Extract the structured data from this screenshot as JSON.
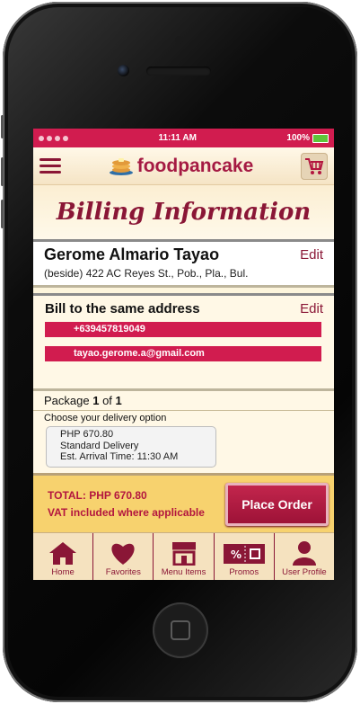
{
  "status": {
    "time": "11:11 AM",
    "battery": "100%"
  },
  "app": {
    "brand": "foodpancake"
  },
  "page": {
    "title": "Billing Information"
  },
  "address": {
    "name": "Gerome Almario Tayao",
    "line": "(beside) 422 AC Reyes St., Pob., Pla., Bul.",
    "edit_label": "Edit"
  },
  "billing": {
    "title": "Bill to the same address",
    "edit_label": "Edit",
    "phone": "+639457819049",
    "email": "tayao.gerome.a@gmail.com"
  },
  "package": {
    "label": "Package",
    "index": "1",
    "of": "of",
    "total": "1",
    "delivery_prompt": "Choose your delivery option",
    "option": {
      "price": "PHP 670.80",
      "type": "Standard Delivery",
      "eta": "Est. Arrival Time: 11:30 AM"
    }
  },
  "order": {
    "total": "TOTAL: PHP 670.80",
    "vat": "VAT included where applicable",
    "place_label": "Place Order"
  },
  "tabs": [
    {
      "label": "Home",
      "icon": "home-icon"
    },
    {
      "label": "Favorites",
      "icon": "heart-icon"
    },
    {
      "label": "Menu Items",
      "icon": "store-icon"
    },
    {
      "label": "Promos",
      "icon": "ticket-icon"
    },
    {
      "label": "User Profile",
      "icon": "user-icon"
    }
  ],
  "colors": {
    "accent": "#d11c4f",
    "dark_accent": "#8a1636",
    "cream": "#fdf5dc",
    "total_bar": "#f7d26e"
  }
}
